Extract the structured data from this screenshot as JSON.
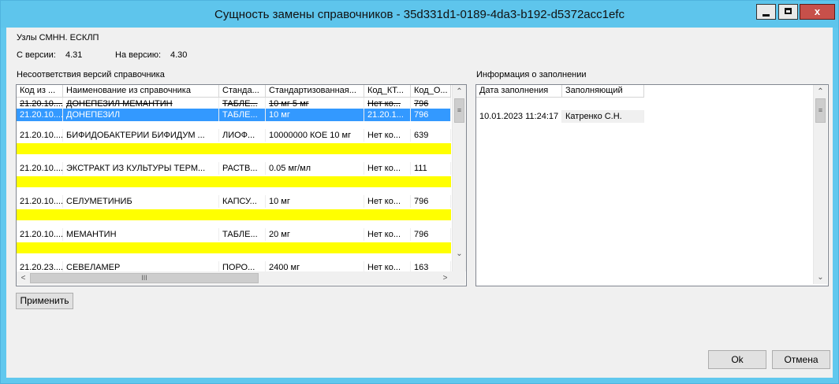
{
  "window": {
    "title": "Сущность замены справочников - 35d331d1-0189-4da3-b192-d5372acc1efc",
    "close_glyph": "x"
  },
  "form": {
    "nodes_label": "Узлы СМНН. ЕСКЛП",
    "from_version_label": "С версии:",
    "from_version_value": "4.31",
    "to_version_label": "На версию:",
    "to_version_value": "4.30",
    "mismatches_label": "Несоответствия версий справочника",
    "fill_info_label": "Информация о заполнении"
  },
  "mismatch_table": {
    "columns": [
      "Код из ...",
      "Наименование из справочника",
      "Станда...",
      "Стандартизованная...",
      "Код_КТ...",
      "Код_О..."
    ],
    "rows": [
      {
        "code": "21.20.10....",
        "name": "ДОНЕПЕЗИЛ МЕМАНТИН",
        "std_form": "ТАБЛЕ...",
        "std_dose": "10 мг 5 мг",
        "code_kt": "Нет ко...",
        "code_o": "796",
        "state": "strikethrough"
      },
      {
        "code": "21.20.10....",
        "name": "ДОНЕПЕЗИЛ",
        "std_form": "ТАБЛЕ...",
        "std_dose": "10 мг",
        "code_kt": "21.20.1...",
        "code_o": "796",
        "state": "selected"
      },
      {
        "code": "21.20.10....",
        "name": "БИФИДОБАКТЕРИИ БИФИДУМ ...",
        "std_form": "ЛИОФ...",
        "std_dose": "10000000 КОЕ 10 мг",
        "code_kt": "Нет ко...",
        "code_o": "639",
        "state": "highlighted"
      },
      {
        "code": "21.20.10....",
        "name": "ЭКСТРАКТ ИЗ КУЛЬТУРЫ ТЕРМ...",
        "std_form": "РАСТВ...",
        "std_dose": "0.05 мг/мл",
        "code_kt": "Нет ко...",
        "code_o": "111",
        "state": "highlighted"
      },
      {
        "code": "21.20.10....",
        "name": "СЕЛУМЕТИНИБ",
        "std_form": "КАПСУ...",
        "std_dose": "10 мг",
        "code_kt": "Нет ко...",
        "code_o": "796",
        "state": "highlighted"
      },
      {
        "code": "21.20.10....",
        "name": "МЕМАНТИН",
        "std_form": "ТАБЛЕ...",
        "std_dose": "20 мг",
        "code_kt": "Нет ко...",
        "code_o": "796",
        "state": "highlighted"
      },
      {
        "code": "21.20.23....",
        "name": "СЕВЕЛАМЕР",
        "std_form": "ПОРО...",
        "std_dose": "2400 мг",
        "code_kt": "Нет ко...",
        "code_o": "163",
        "state": "normal"
      }
    ],
    "highlight_color": "#ffff00",
    "selection_color": "#3399ff"
  },
  "fill_table": {
    "columns": [
      "Дата заполнения",
      "Заполняющий"
    ],
    "rows": [
      {
        "date": "10.01.2023 11:24:17",
        "filler": "Катренко С.Н."
      }
    ]
  },
  "scrollbar": {
    "up_arrow": "⌃",
    "down_arrow": "⌄",
    "left_arrow": "<",
    "right_arrow": ">",
    "grip_v": "≡",
    "grip_h": "III"
  },
  "buttons": {
    "apply": "Применить",
    "ok": "Ok",
    "cancel": "Отмена"
  },
  "colors": {
    "title_bar": "#5ec5ec",
    "close_button": "#c7504a"
  }
}
